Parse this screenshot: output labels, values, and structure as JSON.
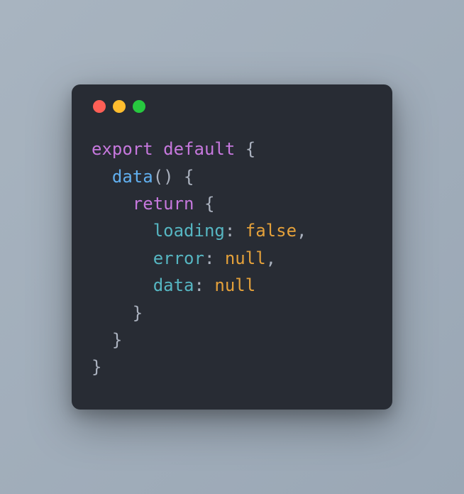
{
  "window": {
    "dots": [
      "red",
      "yellow",
      "green"
    ]
  },
  "code": {
    "tokens": [
      {
        "t": "export",
        "c": "keyword"
      },
      {
        "t": " ",
        "c": "punct"
      },
      {
        "t": "default",
        "c": "keyword"
      },
      {
        "t": " {",
        "c": "punct"
      },
      {
        "t": "\n  ",
        "c": "punct"
      },
      {
        "t": "data",
        "c": "func"
      },
      {
        "t": "() {",
        "c": "punct"
      },
      {
        "t": "\n    ",
        "c": "punct"
      },
      {
        "t": "return",
        "c": "keyword"
      },
      {
        "t": " {",
        "c": "punct"
      },
      {
        "t": "\n      ",
        "c": "punct"
      },
      {
        "t": "loading",
        "c": "prop"
      },
      {
        "t": ": ",
        "c": "punct"
      },
      {
        "t": "false",
        "c": "literal"
      },
      {
        "t": ",",
        "c": "punct"
      },
      {
        "t": "\n      ",
        "c": "punct"
      },
      {
        "t": "error",
        "c": "prop"
      },
      {
        "t": ": ",
        "c": "punct"
      },
      {
        "t": "null",
        "c": "literal"
      },
      {
        "t": ",",
        "c": "punct"
      },
      {
        "t": "\n      ",
        "c": "punct"
      },
      {
        "t": "data",
        "c": "prop"
      },
      {
        "t": ": ",
        "c": "punct"
      },
      {
        "t": "null",
        "c": "literal"
      },
      {
        "t": "\n    }",
        "c": "punct"
      },
      {
        "t": "\n  }",
        "c": "punct"
      },
      {
        "t": "\n}",
        "c": "punct"
      }
    ]
  }
}
